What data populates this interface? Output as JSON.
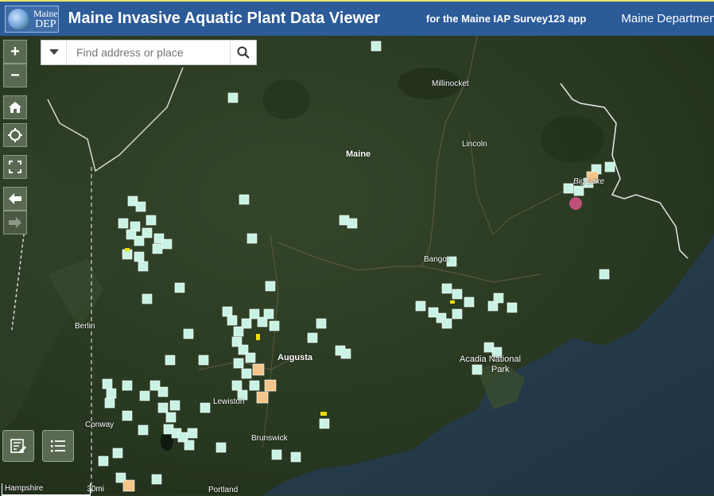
{
  "header": {
    "logo_line1": "Maine",
    "logo_line2": "DEP",
    "title": "Maine Invasive Aquatic Plant Data Viewer",
    "subtitle": "for the Maine IAP Survey123 app",
    "department": "Maine Department of E"
  },
  "search": {
    "placeholder": "Find address or place"
  },
  "controls": {
    "zoom_in": "+",
    "zoom_out": "−",
    "home": "home",
    "locate": "locate",
    "fullscreen": "fullscreen",
    "back": "back",
    "forward": "forward"
  },
  "places": {
    "maine": "Maine",
    "millinocket": "Millinocket",
    "lincoln": "Lincoln",
    "big_lake": "Big Lake",
    "bangor": "Bangor",
    "berlin": "Berlin",
    "augusta": "Augusta",
    "acadia_1": "Acadia National",
    "acadia_2": "Park",
    "lewiston": "Lewiston",
    "conway": "Conway",
    "brunswick": "Brunswick",
    "portland": "Portland",
    "new_hampshire": "Hampshire"
  },
  "scale": {
    "label": "30mi"
  },
  "colors": {
    "header": "#2c5b99",
    "marker_fill": "#c8f2e4",
    "marker_orange": "#f5c58a",
    "marker_yellow": "#e8e000",
    "marker_purple": "#c0507a"
  }
}
